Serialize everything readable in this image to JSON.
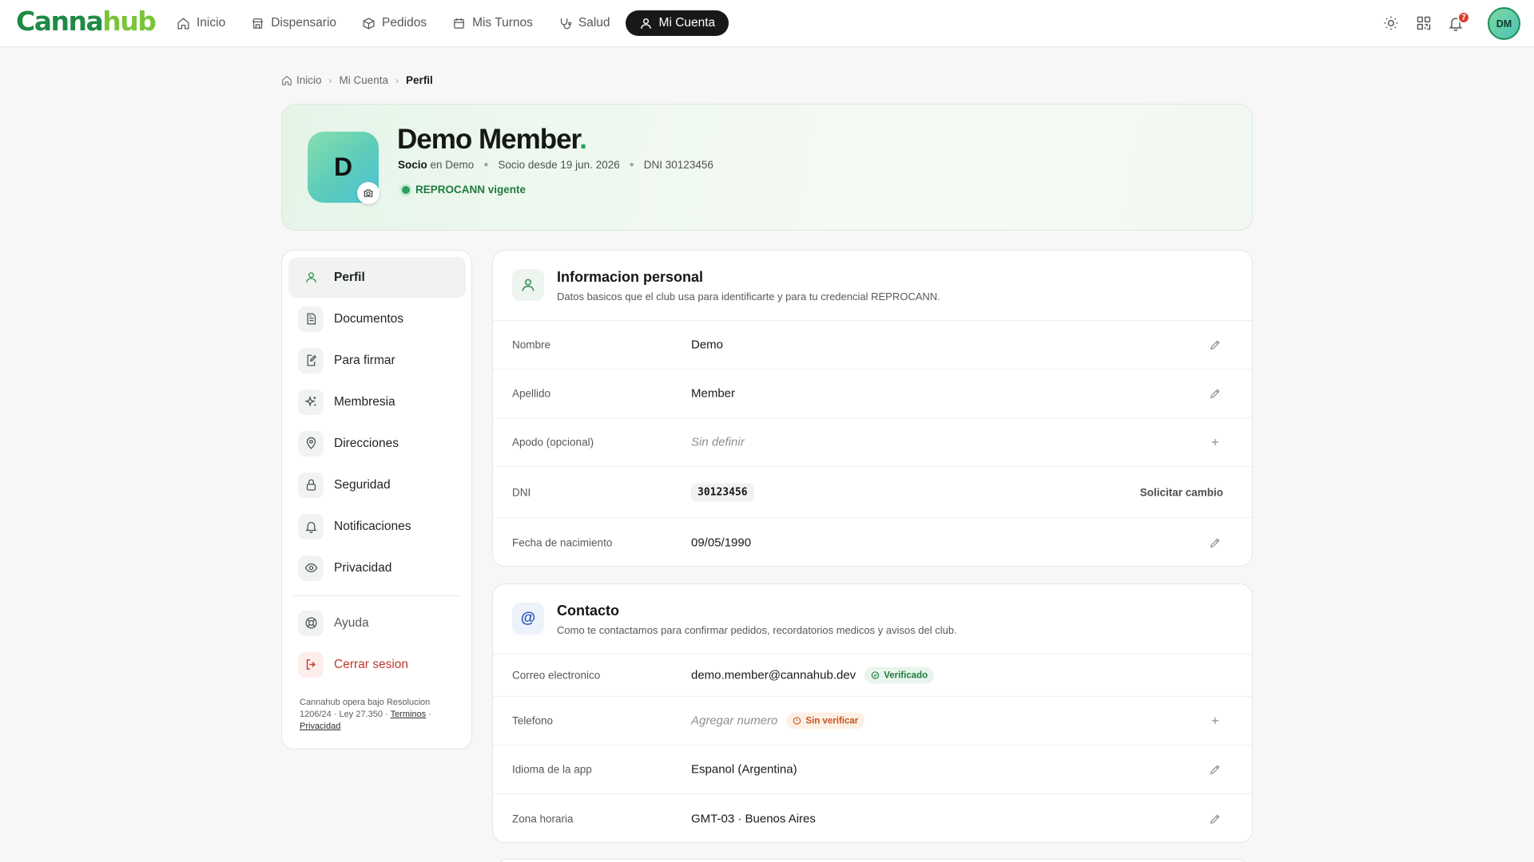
{
  "app": {
    "logo_part1": "Canna",
    "logo_part2": "hub"
  },
  "nav": {
    "items": [
      {
        "label": "Inicio",
        "icon": "home-icon"
      },
      {
        "label": "Dispensario",
        "icon": "store-icon"
      },
      {
        "label": "Pedidos",
        "icon": "package-icon"
      },
      {
        "label": "Mis Turnos",
        "icon": "calendar-icon"
      },
      {
        "label": "Salud",
        "icon": "stethoscope-icon"
      },
      {
        "label": "Mi Cuenta",
        "icon": "user-icon",
        "active": true
      }
    ],
    "notifications_count": "7",
    "avatar_initials": "DM"
  },
  "breadcrumb": {
    "home": "Inicio",
    "section": "Mi Cuenta",
    "current": "Perfil"
  },
  "profile": {
    "initial": "D",
    "name": "Demo Member",
    "name_dot": ".",
    "role": "Socio",
    "club_text": "en Demo",
    "member_since": "Socio desde 19 jun. 2026",
    "dni_text": "DNI 30123456",
    "reprocann": "REPROCANN vigente"
  },
  "side": {
    "items": [
      {
        "label": "Perfil",
        "icon": "user-icon"
      },
      {
        "label": "Documentos",
        "icon": "file-text-icon"
      },
      {
        "label": "Para firmar",
        "icon": "file-pen-icon"
      },
      {
        "label": "Membresia",
        "icon": "sparkles-icon"
      },
      {
        "label": "Direcciones",
        "icon": "map-pin-icon"
      },
      {
        "label": "Seguridad",
        "icon": "lock-icon"
      },
      {
        "label": "Notificaciones",
        "icon": "bell-icon"
      },
      {
        "label": "Privacidad",
        "icon": "eye-icon"
      }
    ],
    "help": "Ayuda",
    "logout": "Cerrar sesion",
    "footer_text": "Cannahub opera bajo Resolucion 1206/24 · Ley 27.350 ·",
    "footer_sep": "·",
    "terms_link": "Terminos",
    "privacy_link": "Privacidad"
  },
  "personal": {
    "title": "Informacion personal",
    "subtitle": "Datos basicos que el club usa para identificarte y para tu credencial REPROCANN.",
    "rows": [
      {
        "label": "Nombre",
        "value": "Demo"
      },
      {
        "label": "Apellido",
        "value": "Member"
      },
      {
        "label": "Apodo (opcional)",
        "value": "Sin definir"
      },
      {
        "label": "DNI",
        "value": "30123456",
        "action": "Solicitar cambio"
      },
      {
        "label": "Fecha de nacimiento",
        "value": "09/05/1990"
      }
    ]
  },
  "contact": {
    "title": "Contacto",
    "icon_glyph": "@",
    "subtitle": "Como te contactamos para confirmar pedidos, recordatorios medicos y avisos del club.",
    "rows": [
      {
        "label": "Correo electronico",
        "value": "demo.member@cannahub.dev",
        "badge": "Verificado"
      },
      {
        "label": "Telefono",
        "value": "Agregar numero",
        "badge": "Sin verificar"
      },
      {
        "label": "Idioma de la app",
        "value": "Espanol (Argentina)"
      },
      {
        "label": "Zona horaria",
        "value": "GMT-03 · Buenos Aires"
      }
    ]
  },
  "colors": {
    "brand_green": "#1f8a46",
    "brand_lime": "#7ac43a",
    "danger": "#c0392b",
    "warning": "#c2541c"
  }
}
